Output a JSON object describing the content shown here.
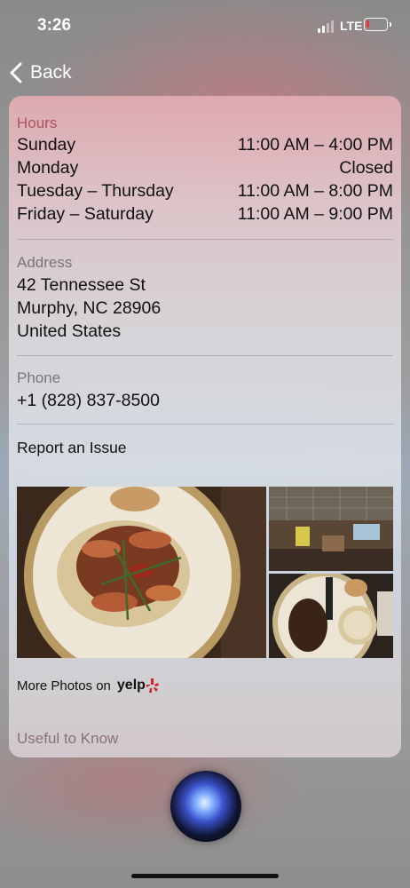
{
  "status_bar": {
    "time": "3:26",
    "network": "LTE",
    "battery_level": "low",
    "battery_color": "#e33333",
    "icons": [
      "signal-icon",
      "battery-icon"
    ]
  },
  "nav": {
    "back_label": "Back",
    "back_icon": "chevron-left-icon"
  },
  "hours": {
    "label": "Hours",
    "label_color": "#b0505d",
    "rows": [
      {
        "day": "Sunday",
        "time": "11:00 AM – 4:00 PM"
      },
      {
        "day": "Monday",
        "time": "Closed"
      },
      {
        "day": "Tuesday – Thursday",
        "time": "11:00 AM – 8:00 PM"
      },
      {
        "day": "Friday – Saturday",
        "time": "11:00 AM – 9:00 PM"
      }
    ]
  },
  "address": {
    "label": "Address",
    "lines": [
      "42 Tennessee St",
      "Murphy, NC  28906",
      "United States"
    ]
  },
  "phone": {
    "label": "Phone",
    "number": "+1 (828) 837-8500"
  },
  "report_issue": "Report an Issue",
  "photos": {
    "items": [
      {
        "name": "shrimp-and-grits-photo"
      },
      {
        "name": "restaurant-interior-photo"
      },
      {
        "name": "steak-dinner-photo"
      }
    ],
    "more_label": "More Photos on",
    "provider": "yelp",
    "provider_color": "#d32323"
  },
  "useful_to_know": "Useful to Know",
  "siri_icon": "siri-orb-icon"
}
